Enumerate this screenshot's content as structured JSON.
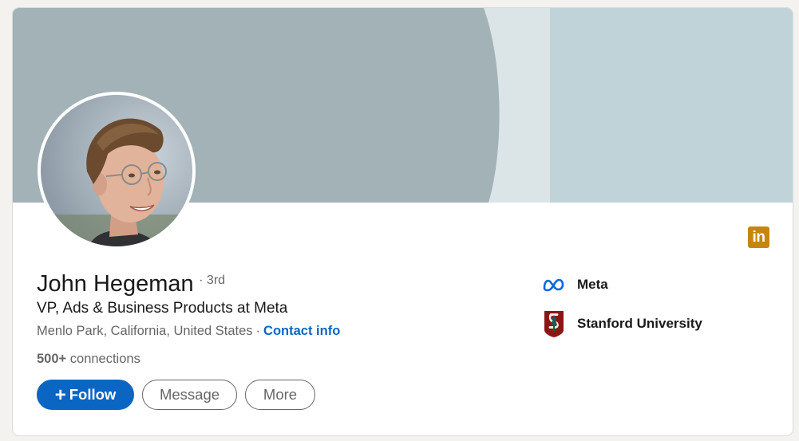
{
  "profile": {
    "name": "John Hegeman",
    "degree": "· 3rd",
    "headline": "VP, Ads & Business Products at Meta",
    "location": "Menlo Park, California, United States",
    "separator": "·",
    "contact_label": "Contact info",
    "connections_count": "500+",
    "connections_label": "connections"
  },
  "actions": {
    "follow_label": "Follow",
    "follow_icon": "+",
    "message_label": "Message",
    "more_label": "More"
  },
  "organizations": [
    {
      "name": "Meta",
      "icon": "meta-logo-icon"
    },
    {
      "name": "Stanford University",
      "icon": "stanford-logo-icon"
    }
  ],
  "badge": {
    "text": "in",
    "icon": "linkedin-icon"
  },
  "colors": {
    "primary_blue": "#0a66c2",
    "banner_dark": "#a2b2b7",
    "banner_light": "#dbe4e6",
    "banner_right": "#c0d3d8",
    "linkedin_badge": "#c4860f",
    "stanford_red": "#8c1515"
  }
}
